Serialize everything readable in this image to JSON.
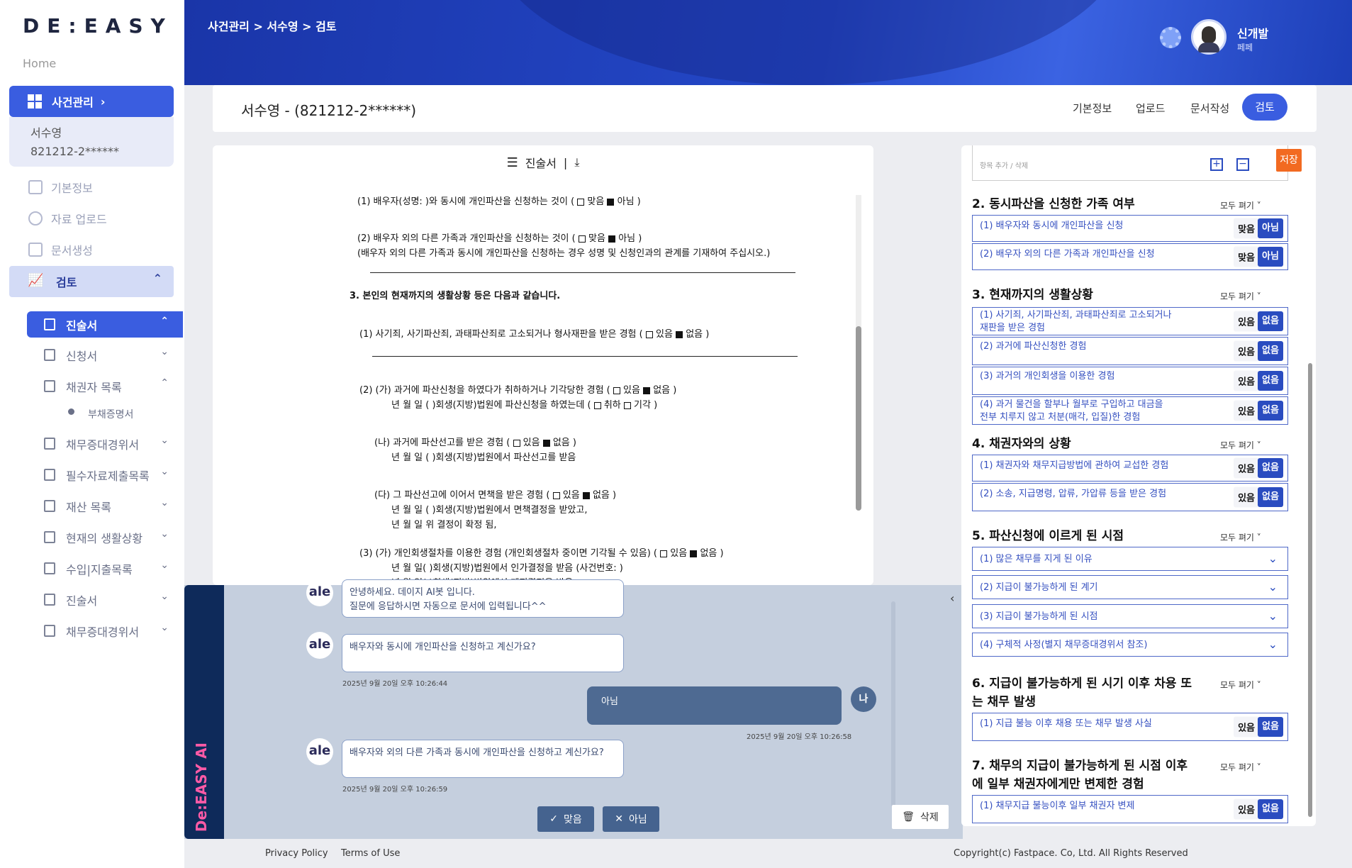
{
  "sidebar": {
    "logo": "DE:EASY",
    "home": "Home",
    "case_menu": "사건관리",
    "client_name": "서수영",
    "client_id": "821212-2******",
    "nav": [
      "기본정보",
      "자료 업로드",
      "문서생성"
    ],
    "review": "검토",
    "docs": [
      {
        "label": "진술서",
        "chev": "⌃"
      },
      {
        "label": "신청서",
        "chev": "⌄"
      },
      {
        "label": "채권자 목록",
        "chev": "⌃"
      },
      {
        "label": "채무증대경위서",
        "chev": "⌄"
      },
      {
        "label": "필수자료제출목록",
        "chev": "⌄"
      },
      {
        "label": "재산 목록",
        "chev": "⌄"
      },
      {
        "label": "현재의 생활상황",
        "chev": "⌄"
      },
      {
        "label": "수입|지출목록",
        "chev": "⌄"
      },
      {
        "label": "진술서",
        "chev": "⌄"
      },
      {
        "label": "채무증대경위서",
        "chev": "⌄"
      }
    ],
    "sub_item": "부채증명서"
  },
  "header": {
    "breadcrumb": "사건관리 > 서수영 > 검토",
    "user_name": "신개발",
    "user_role": "페페"
  },
  "titlebar": {
    "title": "서수영 - (821212-2******)",
    "tabs": [
      "기본정보",
      "업로드",
      "문서작성"
    ],
    "active_tab": "검토"
  },
  "document": {
    "name": "진술서",
    "lines": [
      "(1) 배우자(성명:      )와 동시에 개인파산을 신청하는 것이  (",
      "(2) 배우자 외의 다른 가족과 개인파산을 신청하는 것이  (",
      "(배우자 외의 다른 가족과 동시에 개인파산을 신청하는 경우 성명 및 신청인과의 관계를 기재하여 주십시오.)",
      "3. 본인의 현재까지의 생활상황 등은 다음과 같습니다.",
      "(1) 사기죄, 사기파산죄, 과태파산죄로 고소되거나 형사재판을 받은 경험  (",
      "(2) (가) 과거에 파산신청을 하였다가 취하하거나 기각당한 경험  (",
      "년      월      일 (      )회생(지방)법원에 파산신청을 하였는데 (",
      "(나) 과거에 파산선고를 받은 경험  (",
      "년      월      일 (      )회생(지방)법원에서 파산선고를 받음",
      "(다) 그 파산선고에 이어서 면책을 받은 경험  (",
      "년      월      일 (      )회생(지방)법원에서 면책결정을 받았고,",
      "년      월      일  위 결정이 확정 됨,",
      "(3) (가) 개인회생절차를 이용한 경험 (개인회생절차 중이면 기각될 수 있음)  (",
      "년      월      일(      )회생(지방)법원에서 인가결정을 받음 (사건번호:      )",
      "년      월      일(      )회생(지방)법원에서 폐지결정을 받음"
    ],
    "opt_yes": "맞음",
    "opt_no": "아님",
    "opt_have": "있음",
    "opt_none": "없음",
    "opt_withdraw": "취하",
    "opt_dismiss": "기각"
  },
  "chat": {
    "brand": "De:EASY AI",
    "bot_avatar": "ale",
    "me_avatar": "나",
    "greeting": [
      "안녕하세요. 데이지 AI봇 입니다.",
      "질문에 응답하시면 자동으로 문서에 입력됩니다^^"
    ],
    "q1": "배우자와 동시에 개인파산을 신청하고 계신가요?",
    "q1_time": "2025년 9월 20일 오후 10:26:44",
    "a1": "아님",
    "a1_time": "2025년 9월 20일 오후 10:26:58",
    "q2": "배우자와 외의 다른 가족과 동시에 개인파산을 신청하고 계신가요?",
    "q2_time": "2025년 9월 20일 오후 10:26:59",
    "btn_yes": "맞음",
    "btn_no": "아님",
    "btn_delete": "삭제"
  },
  "footer": {
    "privacy": "Privacy Policy",
    "terms": "Terms of Use",
    "copyright": "Copyright(c) Fastpace. Co, Ltd. All Rights Reserved"
  },
  "right": {
    "save": "저장",
    "add_remove": "항목 추가 / 삭제",
    "fold_all": "모두 펴기 ˅",
    "s2": "2. 동시파산을 신청한 가족 여부",
    "s2_items": [
      "(1) 배우자와 동시에 개인파산을 신청",
      "(2) 배우자 외의 다른 가족과 개인파산을 신청"
    ],
    "s3": "3. 현재까지의 생활상황",
    "s3_items": [
      "(1) 사기죄, 사기파산죄, 과태파산죄로 고소되거나",
      "재판을 받은 경험",
      "(2) 과거에 파산신청한 경험",
      "(3) 과거의 개인회생을 이용한 경험",
      "(4) 과거 물건을 할부나 월부로 구입하고 대금을",
      "전부 치루지 않고 처분(매각, 입질)한 경험"
    ],
    "s4": "4. 채권자와의 상황",
    "s4_items": [
      "(1) 채권자와 채무지급방법에 관하여 교섭한 경험",
      "(2) 소송, 지급명령, 압류, 가압류 등을 받은 경험"
    ],
    "s5": "5. 파산신청에 이르게 된 시점",
    "s5_items": [
      "(1) 많은 채무를 지게 된 이유",
      "(2) 지급이 불가능하게 된 계기",
      "(3) 지급이 불가능하게 된 시점",
      "(4) 구체적 사정(별지 채무증대경위서 참조)"
    ],
    "s6": [
      "6. 지급이 불가능하게 된 시기 이후 차용 또",
      "는 채무 발생"
    ],
    "s6_items": [
      "(1) 지급 불능 이후 채용 또는 채무 발생 사실"
    ],
    "s7": [
      "7. 채무의 지급이 불가능하게 된 시점 이후",
      "에 일부 채권자에게만 변제한 경험"
    ],
    "s7_items": [
      "(1) 채무지급 불능이후 일부 채권자 변제"
    ],
    "yes": "맞음",
    "no": "아님",
    "have": "있음",
    "none": "없음"
  }
}
